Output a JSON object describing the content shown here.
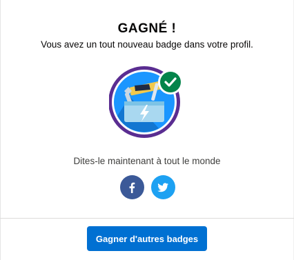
{
  "modal": {
    "title": "GAGNÉ !",
    "subtitle": "Vous avez un tout nouveau badge dans votre profil.",
    "badge_icon": "toolbox-badge-icon",
    "badge_status_icon": "check-icon",
    "share_text": "Dites-le maintenant à tout le monde",
    "social": [
      {
        "name": "facebook",
        "icon": "facebook-icon",
        "color": "#3b5998"
      },
      {
        "name": "twitter",
        "icon": "twitter-icon",
        "color": "#1da1f2"
      }
    ],
    "cta_label": "Gagner d'autres badges"
  },
  "colors": {
    "primary_button": "#0070d2",
    "badge_ring": "#5a2d91",
    "badge_check": "#04844b"
  }
}
